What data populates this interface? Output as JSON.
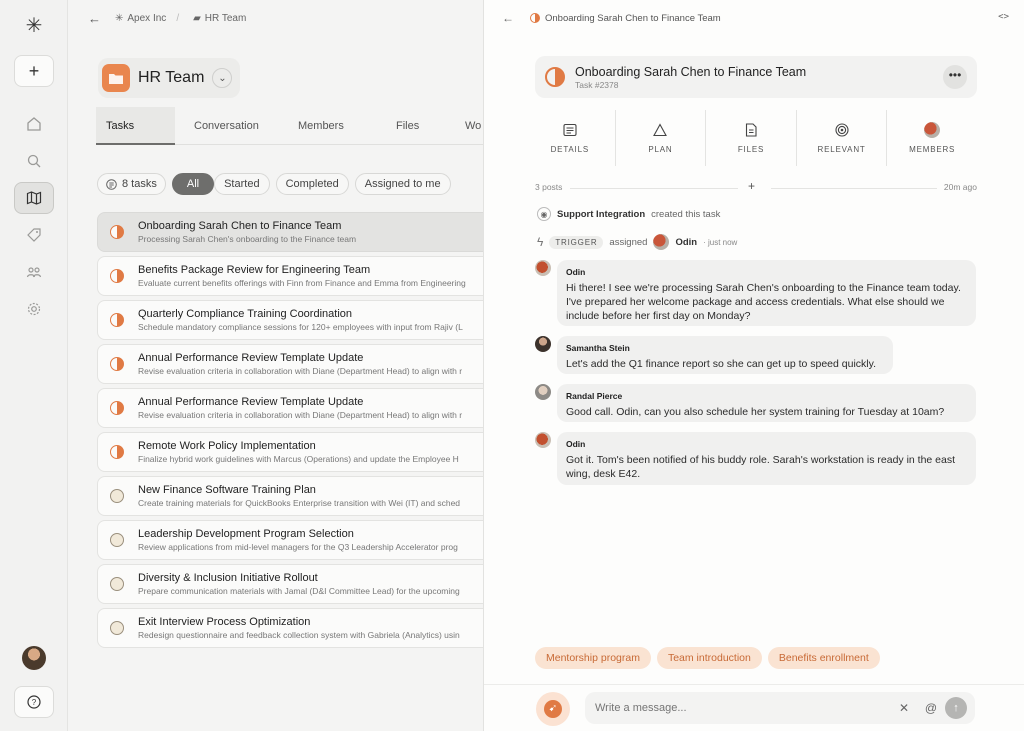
{
  "breadcrumb": {
    "org": "Apex Inc",
    "team": "HR Team"
  },
  "team": {
    "name": "HR Team"
  },
  "tabs": [
    "Tasks",
    "Conversation",
    "Members",
    "Files",
    "Wo"
  ],
  "filters": {
    "count": "8 tasks",
    "all": "All",
    "started": "Started",
    "completed": "Completed",
    "assigned": "Assigned to me"
  },
  "tasks": [
    {
      "title": "Onboarding Sarah Chen to Finance Team",
      "desc": "Processing Sarah Chen's onboarding to the Finance team"
    },
    {
      "title": "Benefits Package Review for Engineering Team",
      "desc": "Evaluate current benefits offerings with Finn from Finance and Emma from Engineering"
    },
    {
      "title": "Quarterly Compliance Training Coordination",
      "desc": "Schedule mandatory compliance sessions for 120+ employees with input from Rajiv (L"
    },
    {
      "title": "Annual Performance Review Template Update",
      "desc": "Revise evaluation criteria in collaboration with Diane (Department Head) to align with r"
    },
    {
      "title": "Annual Performance Review Template Update",
      "desc": "Revise evaluation criteria in collaboration with Diane (Department Head) to align with r"
    },
    {
      "title": "Remote Work Policy Implementation",
      "desc": "Finalize hybrid work guidelines with Marcus (Operations) and update the Employee H"
    },
    {
      "title": "New Finance Software Training Plan",
      "desc": "Create training materials for QuickBooks Enterprise transition with Wei (IT) and sched"
    },
    {
      "title": "Leadership Development Program Selection",
      "desc": "Review applications from mid-level managers for the Q3 Leadership Accelerator prog"
    },
    {
      "title": "Diversity & Inclusion Initiative Rollout",
      "desc": "Prepare communication materials with Jamal (D&I Committee Lead) for the upcoming"
    },
    {
      "title": "Exit Interview Process Optimization",
      "desc": "Redesign questionnaire and feedback collection system with Gabriela (Analytics) usin"
    }
  ],
  "detail": {
    "crumb": "Onboarding Sarah Chen to Finance Team",
    "code_icon": "<>",
    "title": "Onboarding Sarah Chen to Finance Team",
    "task_no": "Task #2378",
    "more": "•••",
    "icon_tabs": [
      "DETAILS",
      "PLAN",
      "FILES",
      "RELEVANT",
      "MEMBERS"
    ],
    "posts": "3 posts",
    "posts_time": "20m ago",
    "event1": {
      "actor": "Support Integration",
      "text": "created this task"
    },
    "event2": {
      "badge": "TRIGGER",
      "verb": "assigned",
      "target": "Odin",
      "time": "· just now"
    },
    "messages": [
      {
        "author": "Odin",
        "text": "Hi there! I see we're processing Sarah Chen's onboarding to the Finance team today. I've prepared her welcome package and access credentials. What else should we include before her first day on Monday?"
      },
      {
        "author": "Samantha Stein",
        "text": "Let's add the Q1 finance report so she can get up to speed quickly."
      },
      {
        "author": "Randal Pierce",
        "text": "Good call. Odin, can you also schedule her system training for Tuesday at 10am?"
      },
      {
        "author": "Odin",
        "text": "Got it. Tom's been notified of his buddy role. Sarah's workstation is ready in the east wing, desk E42."
      }
    ],
    "suggestions": [
      "Mentorship program",
      "Team introduction",
      "Benefits enrollment"
    ],
    "placeholder": "Write a message..."
  },
  "colors": {
    "accent": "#e07a44",
    "accent_soft": "#fae3d2"
  }
}
